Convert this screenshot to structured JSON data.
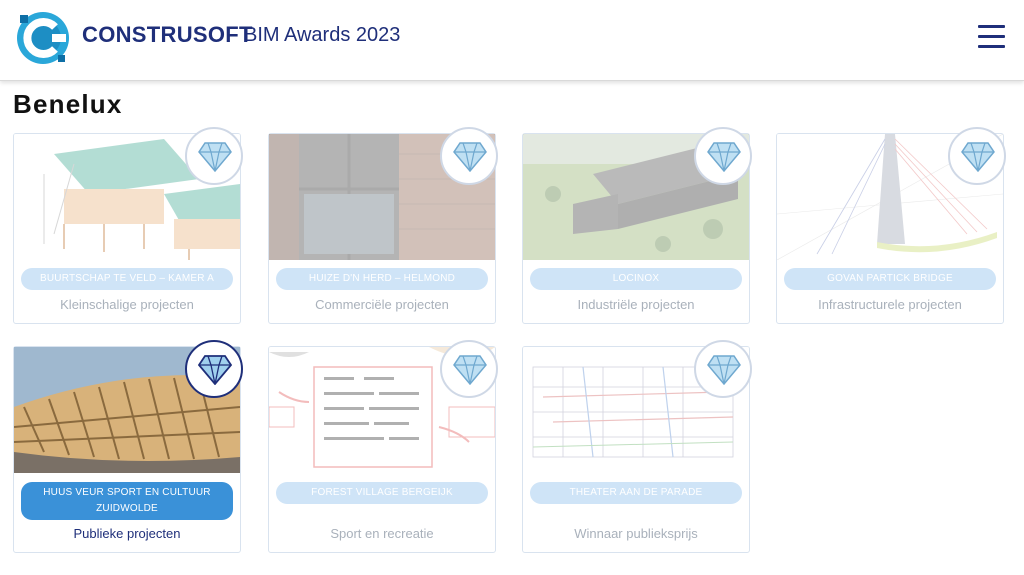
{
  "header": {
    "brand": "CONSTRUSOFT",
    "subtitle": "BIM Awards 2023",
    "logo_icon": "construsoft-logo-icon",
    "menu_icon": "hamburger-menu-icon"
  },
  "region": {
    "title": "Benelux"
  },
  "colors": {
    "brand": "#1f2f7a",
    "pill_inactive": "#cfe4f7",
    "pill_active": "#3a91d8",
    "category_muted": "#a9b1bb"
  },
  "cards": [
    {
      "project": "BUURTSCHAP TE VELD – KAMER A",
      "category": "Kleinschalige projecten",
      "active": false,
      "badge_icon": "diamond-icon"
    },
    {
      "project": "HUIZE D'N HERD – HELMOND",
      "category": "Commerciële projecten",
      "active": false,
      "badge_icon": "diamond-icon"
    },
    {
      "project": "LOCINOX",
      "category": "Industriële projecten",
      "active": false,
      "badge_icon": "diamond-icon"
    },
    {
      "project": "GOVAN PARTICK BRIDGE",
      "category": "Infrastructurele projecten",
      "active": false,
      "badge_icon": "diamond-icon"
    },
    {
      "project": "HUUS VEUR SPORT EN CULTUUR ZUIDWOLDE",
      "category": "Publieke projecten",
      "active": true,
      "badge_icon": "diamond-icon"
    },
    {
      "project": "FOREST VILLAGE BERGEIJK",
      "category": "Sport en recreatie",
      "active": false,
      "badge_icon": "diamond-icon"
    },
    {
      "project": "THEATER AAN DE PARADE",
      "category": "Winnaar publieksprijs",
      "active": false,
      "badge_icon": "diamond-icon"
    }
  ]
}
